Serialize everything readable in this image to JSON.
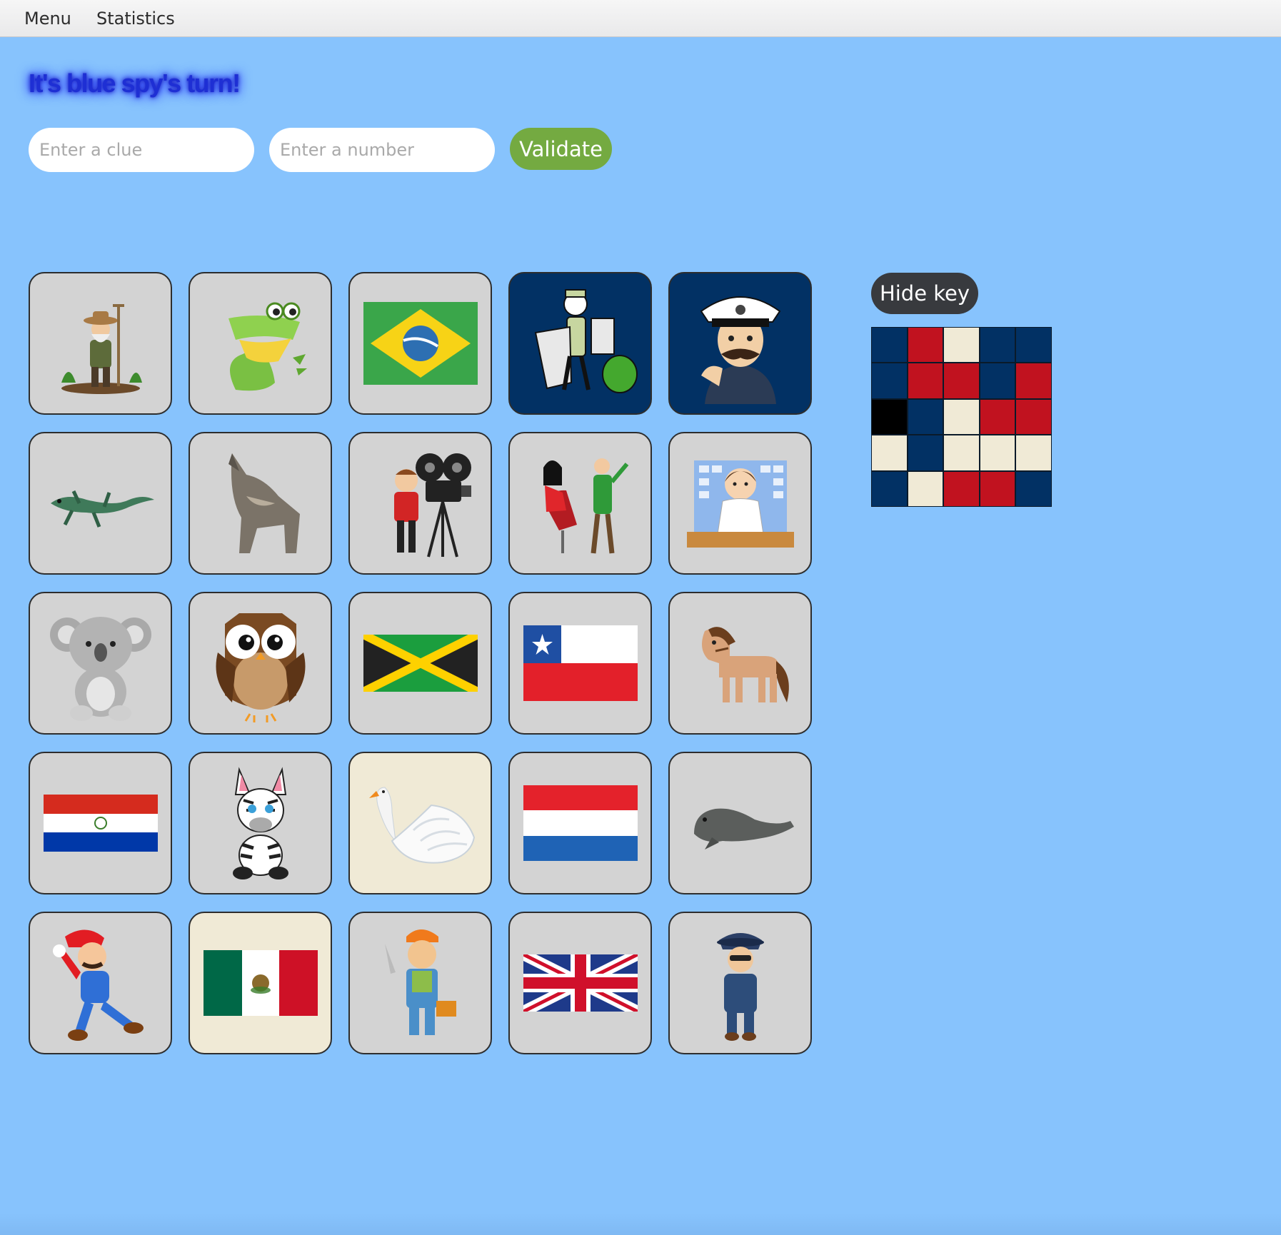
{
  "menubar": {
    "items": [
      "Menu",
      "Statistics"
    ]
  },
  "turn": {
    "message": "It's blue spy's turn!"
  },
  "clue_input": {
    "placeholder": "Enter a clue",
    "value": ""
  },
  "number_input": {
    "placeholder": "Enter a number",
    "value": ""
  },
  "validate_button": {
    "label": "Validate"
  },
  "key_panel": {
    "hide_label": "Hide key"
  },
  "colors": {
    "page_bg": "#87c3fd",
    "card_neutral": "#d3d3d3",
    "card_blue_revealed": "#023164",
    "card_bystander_revealed": "#f0ead6",
    "key_blue": "#023164",
    "key_red": "#c1121f",
    "key_neutral": "#f0ead6",
    "key_assassin": "#000000",
    "validate_green": "#74aa41",
    "title_blue": "#1e2fd4"
  },
  "board": {
    "cards": [
      {
        "name": "gardener-card",
        "icon": "gardener-icon",
        "state": "hidden"
      },
      {
        "name": "crocodile-card",
        "icon": "crocodile-icon",
        "state": "hidden"
      },
      {
        "name": "brazil-flag-card",
        "icon": "brazil-flag-icon",
        "state": "hidden"
      },
      {
        "name": "garbage-collector-card",
        "icon": "garbage-collector-icon",
        "state": "blue"
      },
      {
        "name": "sailor-card",
        "icon": "sailor-captain-icon",
        "state": "blue"
      },
      {
        "name": "lizard-card",
        "icon": "lizard-icon",
        "state": "hidden"
      },
      {
        "name": "wolf-card",
        "icon": "wolf-icon",
        "state": "hidden"
      },
      {
        "name": "filmmaker-card",
        "icon": "movie-camera-icon",
        "state": "hidden"
      },
      {
        "name": "hairdresser-card",
        "icon": "hairdresser-icon",
        "state": "hidden"
      },
      {
        "name": "pharmacist-card",
        "icon": "pharmacist-icon",
        "state": "hidden"
      },
      {
        "name": "koala-card",
        "icon": "koala-icon",
        "state": "hidden"
      },
      {
        "name": "owl-card",
        "icon": "owl-icon",
        "state": "hidden"
      },
      {
        "name": "jamaica-flag-card",
        "icon": "jamaica-flag-icon",
        "state": "hidden"
      },
      {
        "name": "chile-flag-card",
        "icon": "chile-flag-icon",
        "state": "hidden"
      },
      {
        "name": "horse-card",
        "icon": "horse-icon",
        "state": "hidden"
      },
      {
        "name": "paraguay-flag-card",
        "icon": "paraguay-flag-icon",
        "state": "hidden"
      },
      {
        "name": "zebra-card",
        "icon": "zebra-icon",
        "state": "hidden"
      },
      {
        "name": "swan-card",
        "icon": "swan-icon",
        "state": "neutral"
      },
      {
        "name": "netherlands-flag-card",
        "icon": "netherlands-flag-icon",
        "state": "hidden"
      },
      {
        "name": "seal-card",
        "icon": "seal-icon",
        "state": "hidden"
      },
      {
        "name": "mario-card",
        "icon": "mario-icon",
        "state": "hidden"
      },
      {
        "name": "mexico-flag-card",
        "icon": "mexico-flag-icon",
        "state": "neutral"
      },
      {
        "name": "construction-worker-card",
        "icon": "construction-worker-icon",
        "state": "hidden"
      },
      {
        "name": "uk-flag-card",
        "icon": "uk-flag-icon",
        "state": "hidden"
      },
      {
        "name": "police-officer-card",
        "icon": "police-officer-icon",
        "state": "hidden"
      }
    ]
  },
  "key": {
    "rows": [
      [
        "blue",
        "red",
        "neutral",
        "blue",
        "blue"
      ],
      [
        "blue",
        "red",
        "red",
        "blue",
        "red"
      ],
      [
        "assassin",
        "blue",
        "neutral",
        "red",
        "red"
      ],
      [
        "neutral",
        "blue",
        "neutral",
        "neutral",
        "neutral"
      ],
      [
        "blue",
        "neutral",
        "red",
        "red",
        "blue"
      ]
    ]
  }
}
